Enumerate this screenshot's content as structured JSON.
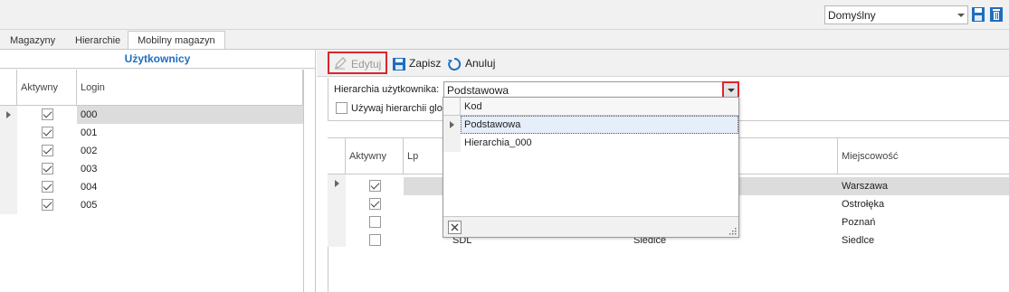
{
  "top_toolbar": {
    "layout_value": "Domyślny",
    "save_icon": "save-icon",
    "delete_icon": "trash-icon",
    "accent": "#1e6ebf"
  },
  "tabs": [
    {
      "label": "Magazyny"
    },
    {
      "label": "Hierarchie"
    },
    {
      "label": "Mobilny magazyn"
    }
  ],
  "left": {
    "title": "Użytkownicy",
    "columns": {
      "active": "Aktywny",
      "login": "Login"
    },
    "rows": [
      {
        "active": true,
        "login": "000"
      },
      {
        "active": true,
        "login": "001"
      },
      {
        "active": true,
        "login": "002"
      },
      {
        "active": true,
        "login": "003"
      },
      {
        "active": true,
        "login": "004"
      },
      {
        "active": true,
        "login": "005"
      }
    ]
  },
  "right": {
    "toolbar": {
      "edit": "Edytuj",
      "save": "Zapisz",
      "cancel": "Anuluj"
    },
    "hierarchy_label": "Hierarchia użytkownika:",
    "hierarchy_value": "Podstawowa",
    "use_global_label": "Używaj hierarchii glob",
    "dropdown": {
      "header": "Kod",
      "items": [
        "Podstawowa",
        "Hierarchia_000"
      ]
    },
    "grid": {
      "columns": {
        "active": "Aktywny",
        "lp": "Lp",
        "city": "Miejscowość"
      },
      "rows": [
        {
          "active": true,
          "code": "",
          "name": "",
          "city": "Warszawa"
        },
        {
          "active": true,
          "code": "",
          "name": "",
          "city": "Ostrołęka"
        },
        {
          "active": false,
          "code": "",
          "name": "",
          "city": "Poznań"
        },
        {
          "active": false,
          "code": "SDL",
          "name": "Siedlce",
          "city": "Siedlce"
        }
      ]
    }
  }
}
